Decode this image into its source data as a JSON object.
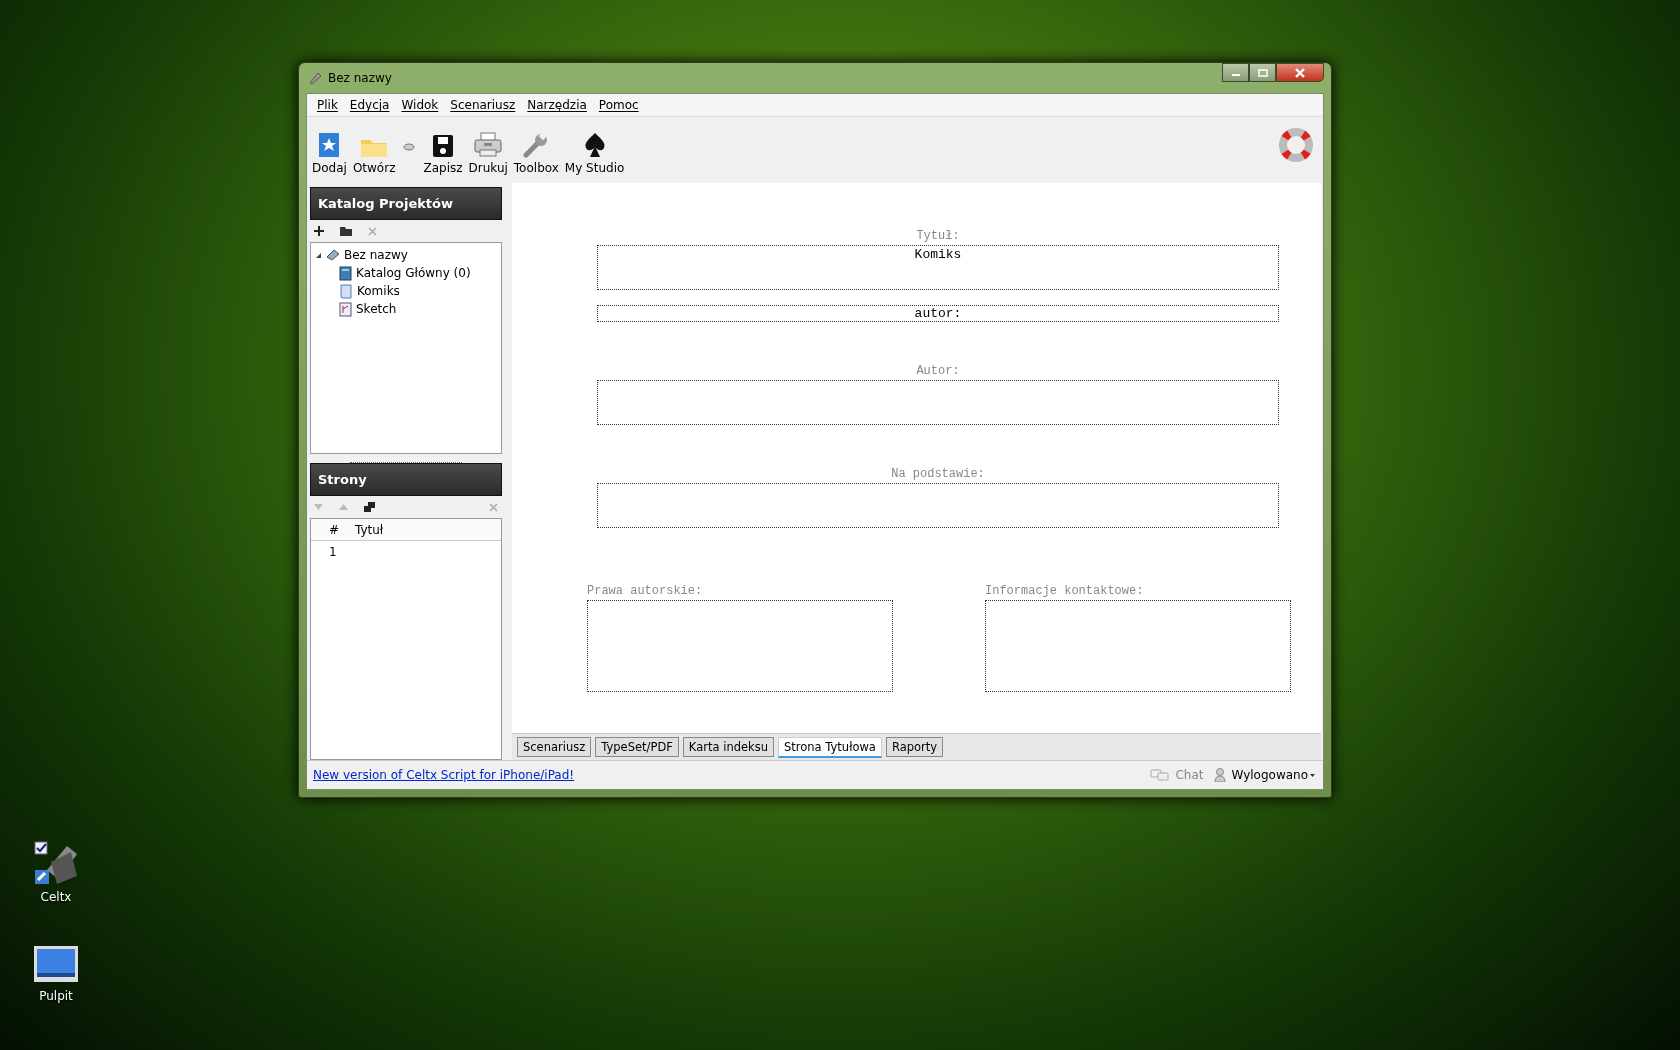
{
  "desktop_icons": [
    {
      "label": "Celtx",
      "kind": "app"
    },
    {
      "label": "Pulpit",
      "kind": "desktop"
    }
  ],
  "window": {
    "title": "Bez nazwy",
    "menu": [
      "Plik",
      "Edycja",
      "Widok",
      "Scenariusz",
      "Narzędzia",
      "Pomoc"
    ],
    "toolbar": [
      {
        "label": "Dodaj",
        "kind": "add"
      },
      {
        "label": "Otwórz",
        "kind": "open"
      },
      {
        "label": "Zapisz",
        "kind": "save"
      },
      {
        "label": "Drukuj",
        "kind": "print"
      },
      {
        "label": "Toolbox",
        "kind": "toolbox"
      },
      {
        "label": "My Studio",
        "kind": "studio"
      }
    ],
    "project_panel": {
      "title": "Katalog Projektów",
      "tree": {
        "label": "Bez nazwy",
        "expanded": true,
        "children": [
          {
            "label": "Katalog Główny (0)",
            "kind": "catalog"
          },
          {
            "label": "Komiks",
            "kind": "comic"
          },
          {
            "label": "Sketch",
            "kind": "sketch"
          }
        ]
      }
    },
    "pages_panel": {
      "title": "Strony",
      "columns": [
        "#",
        "Tytuł"
      ],
      "rows": [
        {
          "number": "1"
        }
      ]
    },
    "title_page": {
      "title_label": "Tytuł:",
      "title_value": "Komiks",
      "byline": "autor:",
      "fields": [
        {
          "label": "Autor:"
        },
        {
          "label": "Na podstawie:"
        }
      ],
      "bottom_fields": [
        {
          "label": "Prawa autorskie:"
        },
        {
          "label": "Informacje kontaktowe:"
        }
      ]
    },
    "tabs": [
      {
        "label": "Scenariusz",
        "selected": false
      },
      {
        "label": "TypeSet/PDF",
        "selected": false
      },
      {
        "label": "Karta indeksu",
        "selected": false
      },
      {
        "label": "Strona Tytułowa",
        "selected": true
      },
      {
        "label": "Raporty",
        "selected": false
      }
    ],
    "status_bar": {
      "link": "New version of Celtx Script for iPhone/iPad!",
      "chat": "Chat",
      "user": "Wylogowano"
    }
  }
}
